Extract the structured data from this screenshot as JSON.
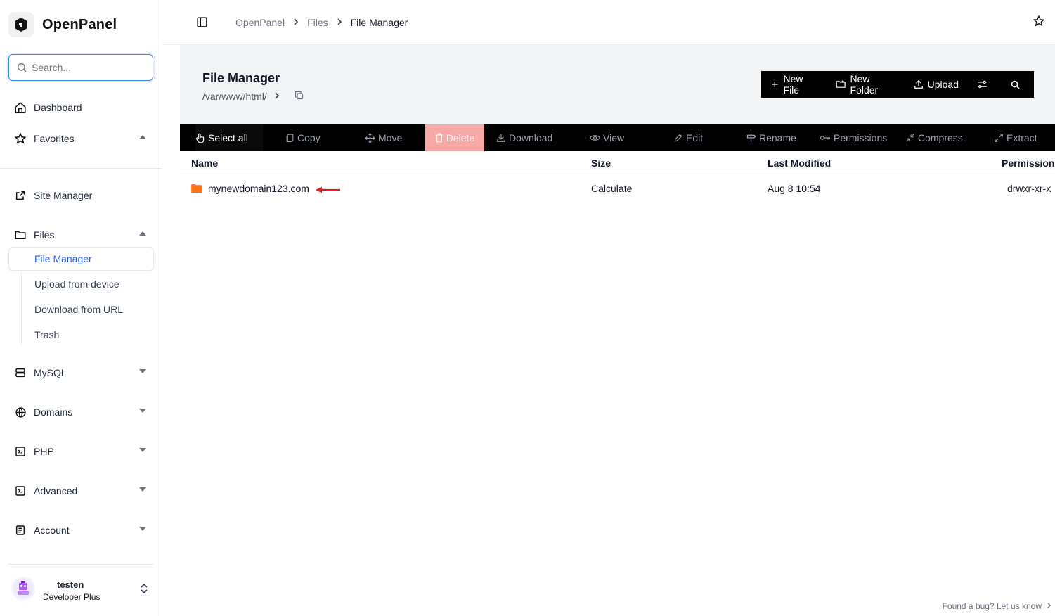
{
  "app": {
    "name": "OpenPanel"
  },
  "search": {
    "placeholder": "Search..."
  },
  "sidebar": {
    "dashboard": "Dashboard",
    "favorites": "Favorites",
    "site_manager": "Site Manager",
    "files": "Files",
    "files_sub": [
      "File Manager",
      "Upload from device",
      "Download from URL",
      "Trash"
    ],
    "mysql": "MySQL",
    "domains": "Domains",
    "php": "PHP",
    "advanced": "Advanced",
    "account": "Account"
  },
  "user": {
    "name": "testen",
    "plan": "Developer Plus"
  },
  "breadcrumb": [
    "OpenPanel",
    "Files",
    "File Manager"
  ],
  "header": {
    "title": "File Manager",
    "path": "/var/www/html/"
  },
  "actions": {
    "new_file": "New File",
    "new_folder": "New Folder",
    "upload": "Upload"
  },
  "toolbar": {
    "select_all": "Select all",
    "copy": "Copy",
    "move": "Move",
    "delete": "Delete",
    "download": "Download",
    "view": "View",
    "edit": "Edit",
    "rename": "Rename",
    "permissions": "Permissions",
    "compress": "Compress",
    "extract": "Extract"
  },
  "table": {
    "columns": [
      "Name",
      "Size",
      "Last Modified",
      "Permissions"
    ],
    "rows": [
      {
        "name": "mynewdomain123.com",
        "size": "Calculate",
        "modified": "Aug 8 10:54",
        "permissions": "drwxr-xr-x"
      }
    ]
  },
  "footer": {
    "bug_link": "Found a bug? Let us know"
  },
  "colors": {
    "accent": "#3b82f6",
    "folder": "#f97316",
    "annotation_arrow": "#e11d1d",
    "delete_bg": "#f9a8a8"
  }
}
